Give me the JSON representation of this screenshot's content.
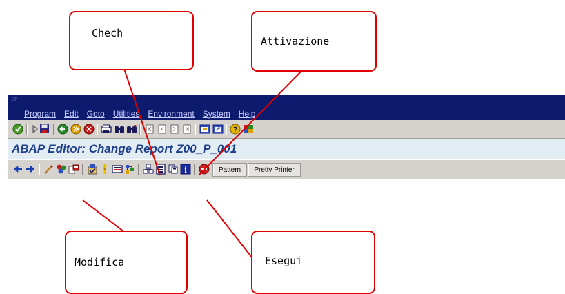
{
  "window": {
    "sap_logo": "☞",
    "menu": [
      "Program",
      "Edit",
      "Goto",
      "Utilities",
      "Environment",
      "System",
      "Help"
    ],
    "title": "ABAP Editor: Change Report Z00_P_001"
  },
  "system_toolbar": {
    "icons": [
      "enter-icon",
      "command-field-arrow-icon",
      "save-icon",
      "back-icon",
      "exit-icon",
      "cancel-icon",
      "print-icon",
      "find-icon",
      "find-next-icon",
      "first-page-icon",
      "previous-page-icon",
      "next-page-icon",
      "last-page-icon",
      "create-session-icon",
      "shortcut-icon",
      "help-icon",
      "customize-layout-icon"
    ]
  },
  "application_toolbar": {
    "icons": [
      "back-arrow-icon",
      "forward-arrow-icon",
      "display-change-icon",
      "active-inactive-icon",
      "other-object-icon",
      "check-icon",
      "activate-icon",
      "test-execute-icon",
      "where-used-icon",
      "object-list-icon",
      "navigation-window-icon",
      "help-info-icon",
      "stop-icon"
    ],
    "pattern_label": "Pattern",
    "pretty_printer_label": "Pretty Printer"
  },
  "annotations": {
    "check": "Chech",
    "activation": "Attivazione",
    "modify": "Modifica",
    "execute": "Esegui",
    "line_color": "#e00000"
  },
  "colors": {
    "menubar": "#0c1b6e",
    "toolbar": "#d6d3ce",
    "title_bar": "#e2ecf3",
    "title_text": "#1d3f8a"
  }
}
